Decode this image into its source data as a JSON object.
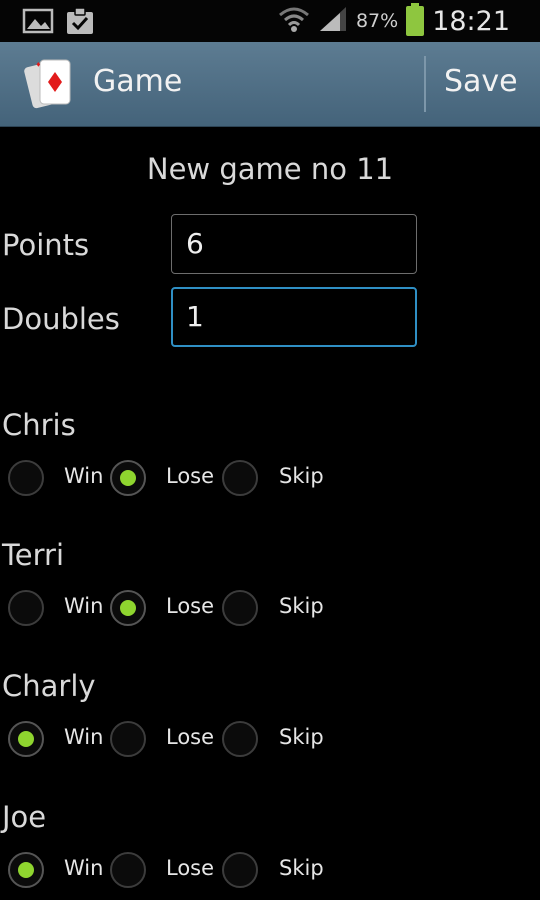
{
  "status_bar": {
    "icons": [
      "image-icon",
      "clipboard-check-icon",
      "wifi-icon",
      "signal-icon",
      "battery-icon"
    ],
    "battery_percent": "87%",
    "time": "18:21"
  },
  "action_bar": {
    "icon": "playing-card-icon",
    "title": "Game",
    "save_label": "Save"
  },
  "form": {
    "heading": "New game no 11",
    "points_label": "Points",
    "points_value": "6",
    "doubles_label": "Doubles",
    "doubles_value": "1"
  },
  "options": {
    "win": "Win",
    "lose": "Lose",
    "skip": "Skip"
  },
  "players": [
    {
      "name": "Chris",
      "selected": "lose"
    },
    {
      "name": "Terri",
      "selected": "lose"
    },
    {
      "name": "Charly",
      "selected": "win"
    },
    {
      "name": "Joe",
      "selected": "win"
    }
  ],
  "colors": {
    "radio_checked": "#8fd52f",
    "focus_border": "#2f8fc4",
    "action_bar": "#527187"
  }
}
